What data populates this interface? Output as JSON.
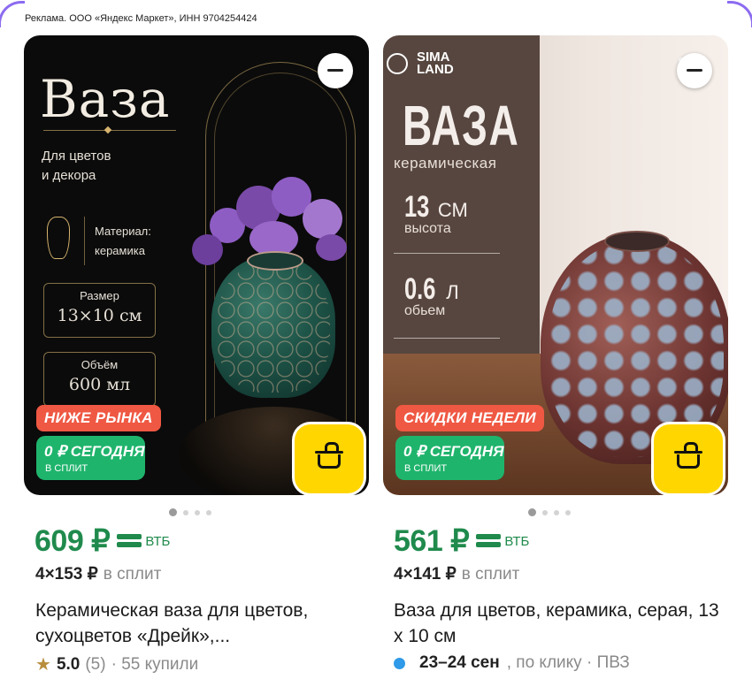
{
  "ad_label": "Реклама. ООО «Яндекс Маркет», ИНН 9704254424",
  "cards": [
    {
      "banner": {
        "title": "Ваза",
        "subtitle_line1": "Для цветов",
        "subtitle_line2": "и декора",
        "material_label": "Материал:",
        "material_value": "керамика",
        "size_label": "Размер",
        "size_value": "13×10 см",
        "volume_label": "Объём",
        "volume_value": "600 мл",
        "promo_label": "НИЖЕ РЫНКА",
        "split_line1": "0 ₽ СЕГОДНЯ",
        "split_line2": "В СПЛИТ"
      },
      "price": "609 ₽",
      "bank": "ВТБ",
      "split_amount": "4×153 ₽",
      "split_word": "в сплит",
      "title": "Керамическая ваза для цветов, сухоцветов «Дрейк»,...",
      "rating": "5.0",
      "reviews": "(5)",
      "bought": "· 55 купили",
      "icon": "star-icon"
    },
    {
      "banner": {
        "brand_line1": "SIMA",
        "brand_line2": "LAND",
        "title": "ВАЗА",
        "subtitle": "керамическая",
        "height_value": "13",
        "height_unit": "СМ",
        "height_caption": "высота",
        "volume_value": "0.6",
        "volume_unit": "Л",
        "volume_caption": "обьем",
        "promo_label": "СКИДКИ НЕДЕЛИ",
        "split_line1": "0 ₽ СЕГОДНЯ",
        "split_line2": "В СПЛИТ"
      },
      "price": "561 ₽",
      "bank": "ВТБ",
      "split_amount": "4×141 ₽",
      "split_word": "в сплит",
      "title": "Ваза для цветов, керамика, серая, 13 х 10 см",
      "delivery_date": "23–24 сен",
      "delivery_rest": ", по клику · ПВЗ",
      "icon": "blue-dot-icon"
    }
  ],
  "colors": {
    "price_green": "#1f8a4c",
    "promo_red": "#ef5843",
    "split_green": "#1fb46c",
    "cart_yellow": "#ffd600",
    "frame_purple": "#8c6cf0"
  }
}
